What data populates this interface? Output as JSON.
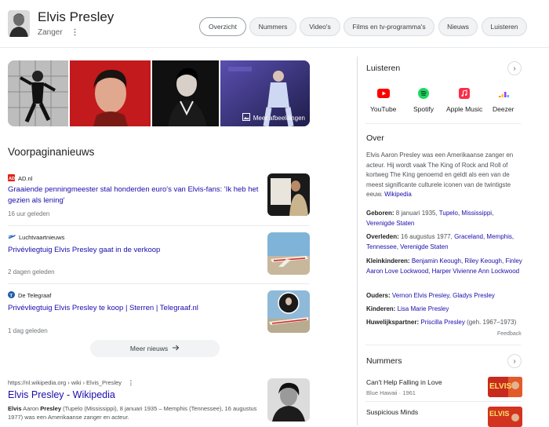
{
  "header": {
    "title": "Elvis Presley",
    "subtitle": "Zanger",
    "more_icon": "⋮",
    "tabs": [
      "Overzicht",
      "Nummers",
      "Video's",
      "Films en tv-programma's",
      "Nieuws",
      "Luisteren"
    ],
    "active_tab": "Overzicht"
  },
  "images": {
    "more_label": "Meer afbeeldingen"
  },
  "news": {
    "heading": "Voorpaginanieuws",
    "items": [
      {
        "source": "AD.nl",
        "title": "Graaiende penningmeester stal honderden euro's van Elvis-fans: 'Ik heb het gezien als lening'",
        "time": "16 uur geleden"
      },
      {
        "source": "Luchtvaartnieuws",
        "title": "Privévliegtuig Elvis Presley gaat in de verkoop",
        "time": "2 dagen geleden"
      },
      {
        "source": "De Telegraaf",
        "title": "Privévliegtuig Elvis Presley te koop | Sterren | Telegraaf.nl",
        "time": "1 dag geleden"
      }
    ],
    "more_button": "Meer nieuws"
  },
  "wiki_result": {
    "breadcrumb": "https://nl.wikipedia.org › wiki › Elvis_Presley",
    "title": "Elvis Presley - Wikipedia",
    "snippet_bold1": "Elvis",
    "snippet_rest1": " Aaron ",
    "snippet_bold2": "Presley",
    "snippet_rest2": " (Tupelo (Mississippi), 8 januari 1935 – Memphis (Tennessee), 16 augustus 1977) was een Amerikaanse zanger en acteur."
  },
  "listen": {
    "heading": "Luisteren",
    "services": [
      "YouTube",
      "Spotify",
      "Apple Music",
      "Deezer"
    ]
  },
  "about": {
    "heading": "Over",
    "text": "Elvis Aaron Presley was een Amerikaanse zanger en acteur. Hij wordt vaak The King of Rock and Roll of kortweg The King genoemd en geldt als een van de meest significante culturele iconen van de twintigste eeuw.",
    "source_link": "Wikipedia",
    "facts": [
      {
        "label": "Geboren:",
        "plain": " 8 januari 1935, ",
        "link": "Tupelo, Mississippi, Verenigde Staten",
        "after": ""
      },
      {
        "label": "Overleden:",
        "plain": " 16 augustus 1977, ",
        "link": "Graceland, Memphis, Tennessee, Verenigde Staten",
        "after": ""
      },
      {
        "label": "Kleinkinderen:",
        "plain": " ",
        "link": "Benjamin Keough, Riley Keough, Finley Aaron Love Lockwood, Harper Vivienne Ann Lockwood",
        "after": ""
      },
      {
        "label": "Ouders:",
        "plain": " ",
        "link": "Vernon Elvis Presley, Gladys Presley",
        "after": ""
      },
      {
        "label": "Kinderen:",
        "plain": " ",
        "link": "Lisa Marie Presley",
        "after": ""
      },
      {
        "label": "Huwelijkspartner:",
        "plain": " ",
        "link": "Priscilla Presley",
        "after": " (geh. 1967–1973)"
      }
    ],
    "feedback": "Feedback"
  },
  "songs": {
    "heading": "Nummers",
    "items": [
      {
        "title": "Can't Help Falling in Love",
        "meta": "Blue Hawaii · 1961"
      },
      {
        "title": "Suspicious Minds",
        "meta": ""
      }
    ]
  },
  "colors": {
    "link": "#1a0dab",
    "youtube": "#ff0000",
    "spotify": "#1ed760",
    "apple_music": "#fa2d48",
    "deezer": "#a238ff"
  }
}
